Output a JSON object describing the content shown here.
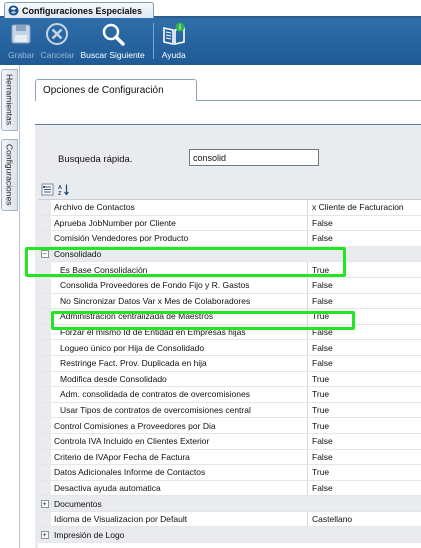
{
  "window": {
    "title": "Configuraciones Especiales",
    "app_icon": "app-logo-icon"
  },
  "toolbar": {
    "items": [
      {
        "label": "Grabar",
        "icon": "save-icon",
        "enabled": false
      },
      {
        "label": "Cancelar",
        "icon": "cancel-icon",
        "enabled": false
      },
      {
        "label": "Buscar Siguiente",
        "icon": "search-icon",
        "enabled": true
      },
      {
        "label": "Ayuda",
        "icon": "help-book-icon",
        "enabled": true
      }
    ]
  },
  "side_tabs": [
    "Herramientas",
    "Configuraciones"
  ],
  "panel": {
    "tab_label": "Opciones de Configuración",
    "search_label": "Busqueda rápida.",
    "search_value": "consolid"
  },
  "grid": {
    "rows": [
      {
        "type": "prop",
        "name": "Archivo de Contactos",
        "value": "x Cliente de Facturacion"
      },
      {
        "type": "prop",
        "name": "Aprueba JobNumber por Cliente",
        "value": "False"
      },
      {
        "type": "prop",
        "name": "Comisión Vendedores por Producto",
        "value": "False"
      },
      {
        "type": "category",
        "name": "Consolidado",
        "value": "",
        "expanded": true
      },
      {
        "type": "child",
        "name": "Es Base Consolidación",
        "value": "True"
      },
      {
        "type": "child",
        "name": "Consolida Proveedores de Fondo Fijo y R. Gastos",
        "value": "False"
      },
      {
        "type": "child",
        "name": "No Sincronizar Datos Var x Mes de Colaboradores",
        "value": "False"
      },
      {
        "type": "child",
        "name": "Administración centralizada de Maestros",
        "value": "True"
      },
      {
        "type": "child",
        "name": "Forzar el mismo Id de Entidad en Empresas hijas",
        "value": "False"
      },
      {
        "type": "child",
        "name": "Logueo único por Hija de Consolidado",
        "value": "False"
      },
      {
        "type": "child",
        "name": "Restringe Fact. Prov. Duplicada en hija",
        "value": "False"
      },
      {
        "type": "child",
        "name": "Modifica desde Consolidado",
        "value": "True"
      },
      {
        "type": "child",
        "name": "Adm. consolidada de contratos de overcomisiones",
        "value": "True"
      },
      {
        "type": "child",
        "name": "Usar Tipos de contratos de overcomisiones  central",
        "value": "True"
      },
      {
        "type": "prop",
        "name": "Control Comisiones a Proveedores por Dia",
        "value": "True"
      },
      {
        "type": "prop",
        "name": "Controla IVA Incluido en Clientes Exterior",
        "value": "False"
      },
      {
        "type": "prop",
        "name": "Criterio de IVApor Fecha de Factura",
        "value": "False"
      },
      {
        "type": "prop",
        "name": "Datos Adicionales Informe de Contactos",
        "value": "True"
      },
      {
        "type": "prop",
        "name": "Desactiva ayuda automatica",
        "value": "False"
      },
      {
        "type": "category",
        "name": "Documentos",
        "value": "",
        "expanded": false
      },
      {
        "type": "prop",
        "name": "Idioma de Visualizacion por Default",
        "value": "Castellano"
      },
      {
        "type": "category",
        "name": "Impresión de Logo",
        "value": "",
        "expanded": false
      }
    ]
  },
  "colors": {
    "toolbar": "#1f5a95",
    "highlight": "#22e622",
    "grid_category_bg": "#e9ebee"
  }
}
